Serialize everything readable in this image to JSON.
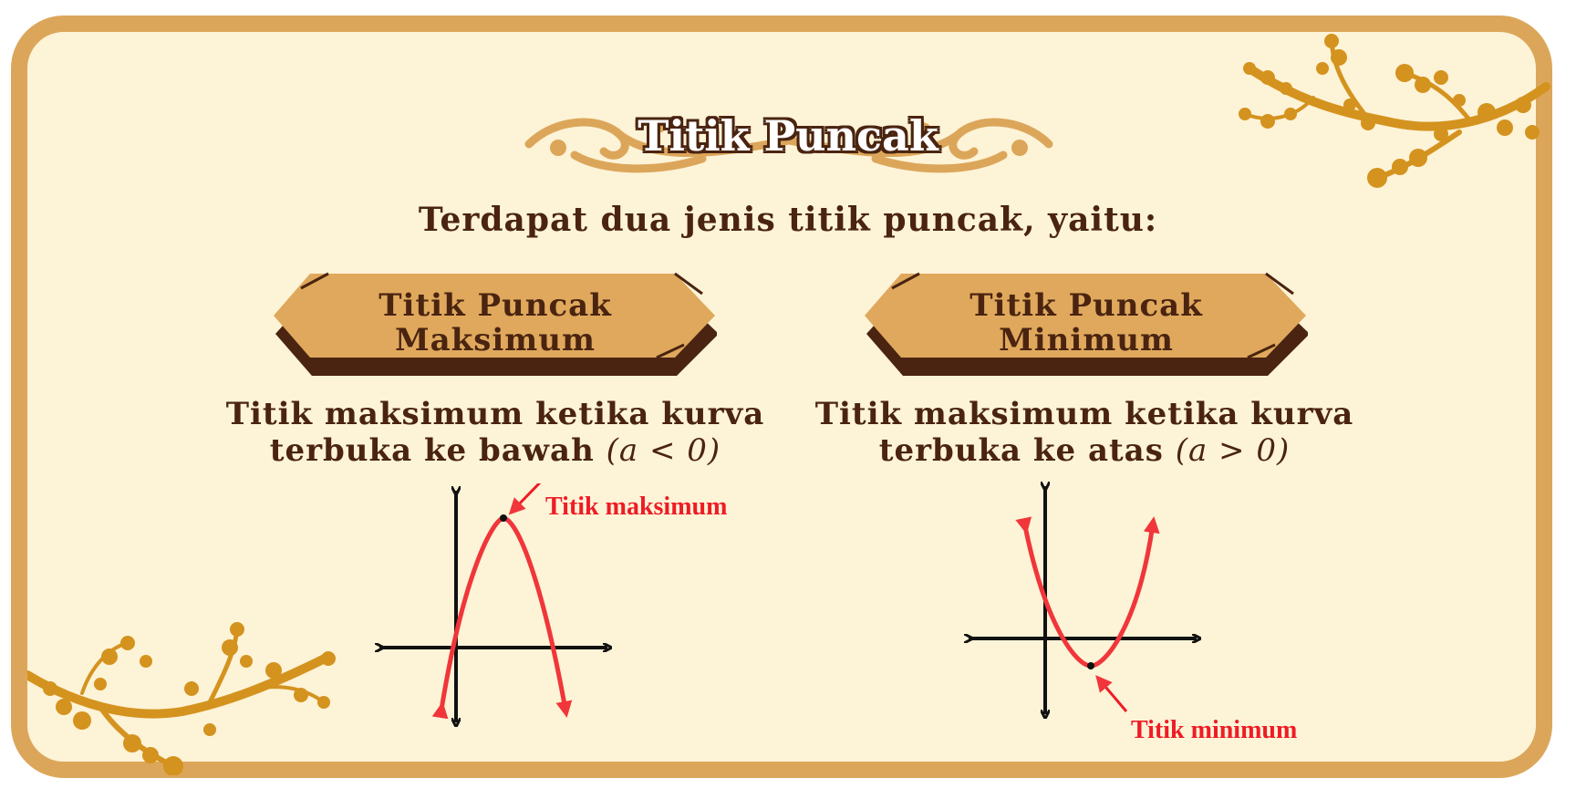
{
  "title": "Titik Puncak",
  "subtitle": "Terdapat dua jenis titik puncak, yaitu:",
  "colors": {
    "frame": "#dca65a",
    "background": "#fdf3d7",
    "text": "#4a2410",
    "sign": "#dfa85c",
    "sign_shadow": "#4a2410",
    "branch": "#d4931e",
    "curve": "#f0363a",
    "callout": "#ee1c25"
  },
  "panels": [
    {
      "sign_line1": "Titik Puncak",
      "sign_line2": "Maksimum",
      "desc_line1": "Titik maksimum ketika kurva",
      "desc_line2_text": "terbuka ke bawah",
      "desc_math": "(a < 0)",
      "callout": "Titik maksimum",
      "curve_shape": "parabola-opening-down"
    },
    {
      "sign_line1": "Titik Puncak",
      "sign_line2": "Minimum",
      "desc_line1": "Titik maksimum ketika kurva",
      "desc_line2_text": "terbuka ke atas",
      "desc_math": "(a > 0)",
      "callout": "Titik minimum",
      "curve_shape": "parabola-opening-up"
    }
  ],
  "decorations": [
    "flourish-ornament",
    "autumn-branch-top-right",
    "autumn-branch-bottom-left"
  ]
}
